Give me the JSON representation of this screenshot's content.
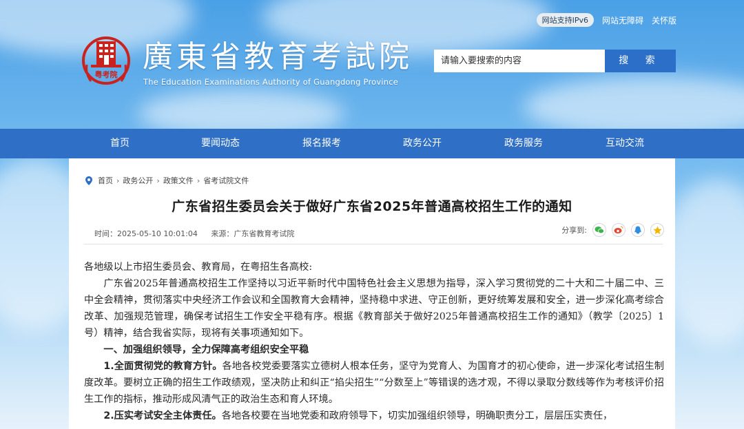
{
  "top_links": {
    "ipv6": "网站支持IPv6",
    "accessible": "网站无障碍",
    "care": "关怀版"
  },
  "header": {
    "site_name": "廣東省教育考試院",
    "site_name_en": "The Education Examinations Authority of Guangdong Province",
    "logo_text": "粤考院"
  },
  "search": {
    "placeholder": "请输入要搜索的内容",
    "button": "搜 索"
  },
  "nav": [
    "首页",
    "要闻动态",
    "报名报考",
    "政务公开",
    "政务服务",
    "互动交流"
  ],
  "breadcrumb": [
    "首页",
    "政务公开",
    "政策文件",
    "省考试院文件"
  ],
  "breadcrumb_sep": "›",
  "article": {
    "title": "广东省招生委员会关于做好广东省2025年普通高校招生工作的通知",
    "time": "时间：2025-05-10 10:01:04",
    "source": "来源：广东省教育考试院",
    "share_label": "分享到:",
    "greeting": "各地级以上市招生委员会、教育局，在粤招生各高校:",
    "para1": "广东省2025年普通高校招生工作坚持以习近平新时代中国特色社会主义思想为指导，深入学习贯彻党的二十大和二十届二中、三中全会精神，贯彻落实中央经济工作会议和全国教育大会精神，坚持稳中求进、守正创新，更好统筹发展和安全，进一步深化高考综合改革、加强规范管理，确保考试招生工作安全平稳有序。根据《教育部关于做好2025年普通高校招生工作的通知》（教学〔2025〕1号）精神，结合我省实际，现将有关事项通知如下。",
    "section1": "一、加强组织领导，全力保障高考组织安全平稳",
    "item1_lead": "1.全面贯彻党的教育方针。",
    "item1_text": "各地各校党委要落实立德树人根本任务，坚守为党育人、为国育才的初心使命，进一步深化考试招生制度改革。要树立正确的招生工作政绩观，坚决防止和纠正“掐尖招生”“分数至上”等错误的选才观，不得以录取分数线等作为考核评价招生工作的指标，推动形成风清气正的政治生态和育人环境。",
    "item2_lead": "2.压实考试安全主体责任。",
    "item2_text": "各地各校要在当地党委和政府领导下，切实加强组织领导，明确职责分工，层层压实责任，"
  },
  "colors": {
    "nav_bg": "#2f6fc6",
    "search_btn": "#2c6fc9",
    "logo_red": "#c8231f"
  }
}
